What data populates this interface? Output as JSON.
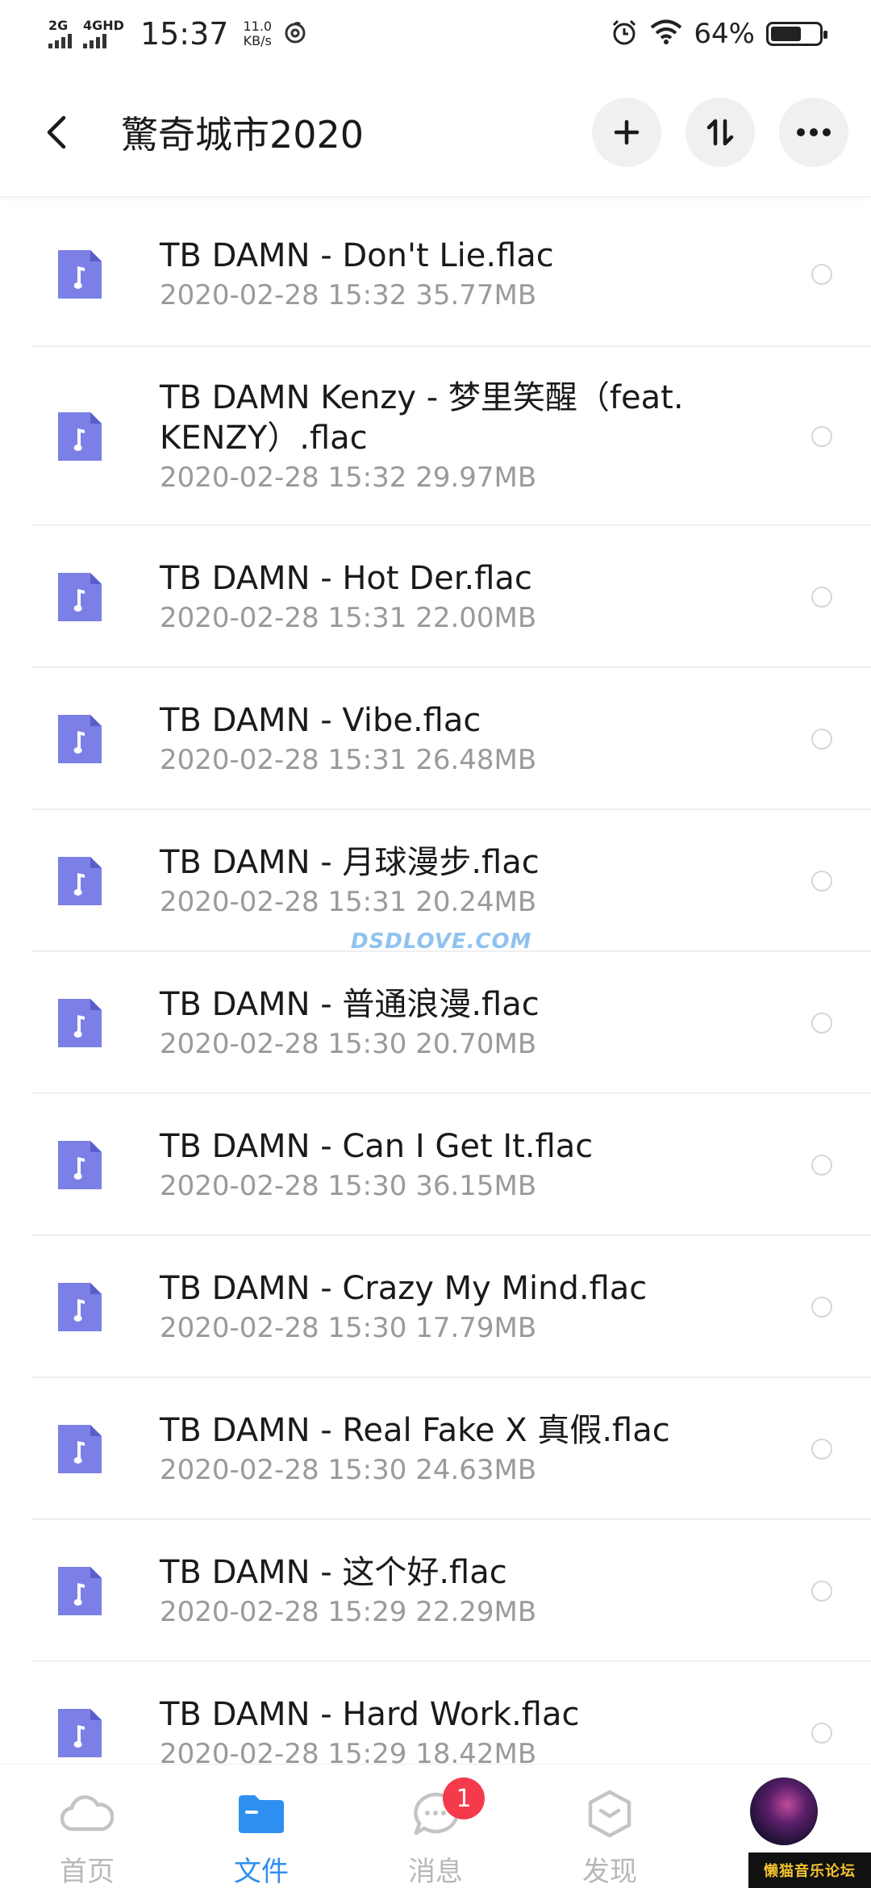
{
  "status_bar": {
    "signal_1": "2G",
    "signal_2": "4GHD",
    "time": "15:37",
    "speed_value": "11.0",
    "speed_unit": "KB/s",
    "battery_percent": "64%",
    "battery_level": 0.64
  },
  "header": {
    "title": "驚奇城市2020"
  },
  "files": [
    {
      "name": "TB DAMN - Don't Lie.flac",
      "meta": "2020-02-28  15:32  35.77MB"
    },
    {
      "name": "TB DAMN Kenzy - 梦里笑醒（feat. KENZY）.flac",
      "meta": "2020-02-28  15:32  29.97MB"
    },
    {
      "name": "TB DAMN - Hot Der.flac",
      "meta": "2020-02-28  15:31  22.00MB"
    },
    {
      "name": "TB DAMN - Vibe.flac",
      "meta": "2020-02-28  15:31  26.48MB"
    },
    {
      "name": "TB DAMN - 月球漫步.flac",
      "meta": "2020-02-28  15:31  20.24MB"
    },
    {
      "name": "TB DAMN - 普通浪漫.flac",
      "meta": "2020-02-28  15:30  20.70MB"
    },
    {
      "name": "TB DAMN - Can I Get It.flac",
      "meta": "2020-02-28  15:30  36.15MB"
    },
    {
      "name": "TB DAMN - Crazy My Mind.flac",
      "meta": "2020-02-28  15:30  17.79MB"
    },
    {
      "name": "TB DAMN - Real Fake X 真假.flac",
      "meta": "2020-02-28  15:30  24.63MB"
    },
    {
      "name": "TB DAMN - 这个好.flac",
      "meta": "2020-02-28  15:29  22.29MB"
    },
    {
      "name": "TB DAMN - Hard Work.flac",
      "meta": "2020-02-28  15:29  18.42MB"
    }
  ],
  "watermark": "DSDLOVE.COM",
  "nav": {
    "home": "首页",
    "files": "文件",
    "messages": "消息",
    "messages_badge": "1",
    "discover": "发现"
  },
  "forum_tag": "懒猫音乐论坛",
  "colors": {
    "accent": "#2e8ff0",
    "file_icon": "#7b7fe6",
    "badge": "#f53a4c"
  }
}
